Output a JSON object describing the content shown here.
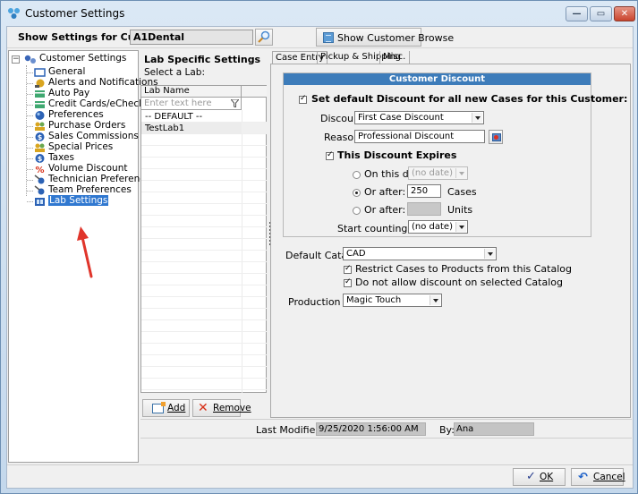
{
  "window": {
    "title": "Customer Settings",
    "controls": {
      "minimize": "—",
      "maximize": "▭",
      "close": "✕"
    }
  },
  "topbar": {
    "customer_label": "Show Settings for Customer:",
    "customer_value": "A1Dental",
    "browse_button": "Show Customer Browse"
  },
  "tree": {
    "root": "Customer Settings",
    "expander": "−",
    "items": [
      {
        "label": "General",
        "icon": "monitor-icon",
        "color": "#2c62b5"
      },
      {
        "label": "Alerts and Notifications",
        "icon": "alert-icon",
        "color": "#d9a520"
      },
      {
        "label": "Auto Pay",
        "icon": "credit-card-icon",
        "color": "#3fa870"
      },
      {
        "label": "Credit Cards/eChecks",
        "icon": "credit-card-icon",
        "color": "#3fa870"
      },
      {
        "label": "Preferences",
        "icon": "globe-icon",
        "color": "#2c62b5"
      },
      {
        "label": "Purchase Orders",
        "icon": "users-icon",
        "color": "#d9a520"
      },
      {
        "label": "Sales Commissions",
        "icon": "dollar-icon",
        "color": "#2c62b5"
      },
      {
        "label": "Special Prices",
        "icon": "users-icon",
        "color": "#d9a520"
      },
      {
        "label": "Taxes",
        "icon": "dollar-icon",
        "color": "#2c62b5"
      },
      {
        "label": "Volume Discount",
        "icon": "percent-icon",
        "color": "#d83018"
      },
      {
        "label": "Technician Preferences",
        "icon": "technician-icon",
        "color": "#2c62b5"
      },
      {
        "label": "Team Preferences",
        "icon": "technician-icon",
        "color": "#2c62b5"
      },
      {
        "label": "Lab Settings",
        "icon": "lab-icon",
        "color": "#2c62b5",
        "selected": true
      }
    ]
  },
  "lab_panel": {
    "title": "Lab Specific Settings",
    "subtitle": "Select a Lab:",
    "column_header": "Lab Name",
    "filter_placeholder": "Enter text here",
    "rows": [
      "-- DEFAULT --",
      "TestLab1"
    ],
    "add_button": "Add",
    "remove_button": "Remove"
  },
  "tabs": [
    {
      "label": "Case Entry",
      "active": true
    },
    {
      "label": "Pickup & Shipping",
      "active": false
    },
    {
      "label": "Misc.",
      "active": false
    }
  ],
  "discount": {
    "header": "Customer Discount",
    "set_default_label": "Set default Discount for all new Cases for this Customer:",
    "set_default_checked": true,
    "discount_label": "Discount:",
    "discount_value": "First Case Discount",
    "reason_label": "Reason:",
    "reason_value": "Professional Discount",
    "expires_label": "This Discount Expires",
    "expires_checked": true,
    "on_date_label": "On this date:",
    "on_date_value": "(no date)",
    "on_date_selected": false,
    "after_cases_label": "Or after:",
    "after_cases_value": "250",
    "after_cases_unit": "Cases",
    "after_cases_selected": true,
    "after_units_label": "Or after:",
    "after_units_value": "",
    "after_units_unit": "Units",
    "after_units_selected": false,
    "start_counting_label": "Start counting after",
    "start_counting_value": "(no date)"
  },
  "catalog": {
    "default_catalog_label": "Default Catalog:",
    "default_catalog_value": "CAD",
    "restrict_label": "Restrict Cases to Products from this Catalog",
    "restrict_checked": true,
    "no_discount_label": "Do not allow discount on selected Catalog",
    "no_discount_checked": true,
    "production_lab_label": "Production Lab:",
    "production_lab_value": "Magic Touch"
  },
  "status": {
    "last_modified_label": "Last Modified On:",
    "last_modified_value": "9/25/2020 1:56:00 AM",
    "by_label": "By:",
    "by_value": "Ana"
  },
  "buttons": {
    "ok": "OK",
    "cancel": "Cancel"
  },
  "colors": {
    "accent": "#3d7cba",
    "selection": "#3078d0",
    "annotation_arrow": "#e0352b"
  }
}
